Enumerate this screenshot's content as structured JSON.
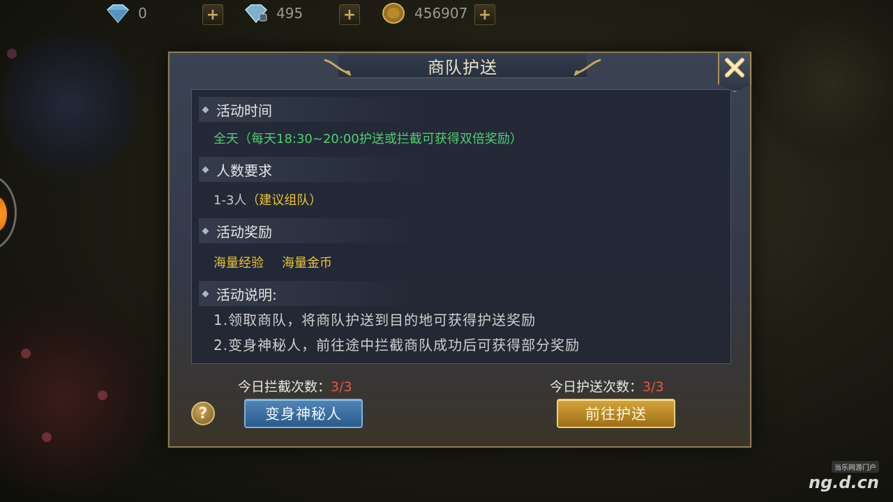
{
  "resources": [
    {
      "icon": "diamond-icon",
      "value": "0"
    },
    {
      "icon": "bound-diamond-icon",
      "value": "495"
    },
    {
      "icon": "gold-coin-icon",
      "value": "456907"
    }
  ],
  "dialog": {
    "title": "商队护送",
    "sections": {
      "time": {
        "heading": "活动时间",
        "text": "全天（每天18:30~20:00护送或拦截可获得双倍奖励）"
      },
      "players": {
        "heading": "人数要求",
        "count": "1-3人",
        "note": "（建议组队）"
      },
      "rewards": {
        "heading": "活动奖励",
        "items": [
          "海量经验",
          "海量金币"
        ]
      },
      "description": {
        "heading": "活动说明:",
        "lines": [
          "1.领取商队，将商队护送到目的地可获得护送奖励",
          "2.变身神秘人，前往途中拦截商队成功后可获得部分奖励"
        ]
      }
    },
    "intercept": {
      "label": "今日拦截次数：",
      "value": "3/3"
    },
    "escort": {
      "label": "今日护送次数：",
      "value": "3/3"
    },
    "buttons": {
      "help": "?",
      "transform": "变身神秘人",
      "go_escort": "前往护送"
    }
  },
  "watermark": {
    "small": "当乐网游门户",
    "big": "ng.d.cn"
  },
  "colors": {
    "green_text": "#4fd06e",
    "yellow_text": "#e8c43b",
    "count_red": "#e25a44",
    "frame_gold": "#8c7a55"
  }
}
